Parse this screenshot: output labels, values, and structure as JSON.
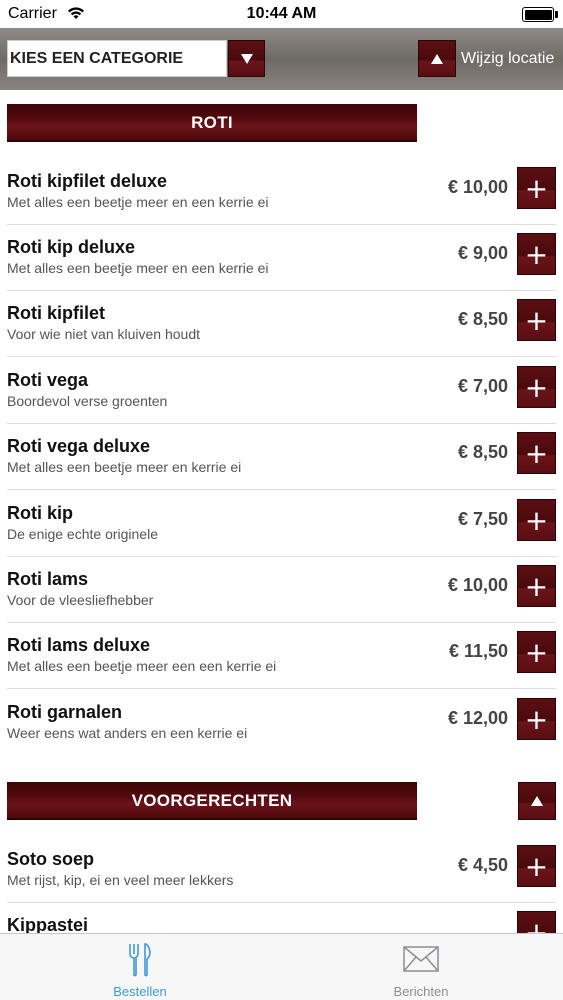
{
  "status_bar": {
    "carrier": "Carrier",
    "time": "10:44 AM"
  },
  "header": {
    "category_select": {
      "value": "KIES EEN CATEGORIE",
      "dropdown_icon": "triangle-down-icon"
    },
    "location_button": {
      "label": "Wijzig locatie",
      "icon": "triangle-up-icon"
    }
  },
  "sections": [
    {
      "title": "ROTI",
      "items": [
        {
          "name": "Roti kipfilet deluxe",
          "description": "Met alles een beetje meer en een kerrie ei",
          "price": "€ 10,00"
        },
        {
          "name": "Roti kip deluxe",
          "description": "Met alles een beetje meer en een kerrie ei",
          "price": "€ 9,00"
        },
        {
          "name": "Roti kipfilet",
          "description": "Voor wie niet van kluiven houdt",
          "price": "€ 8,50"
        },
        {
          "name": "Roti vega",
          "description": "Boordevol verse groenten",
          "price": "€ 7,00"
        },
        {
          "name": "Roti vega deluxe",
          "description": "Met alles een beetje meer en kerrie ei",
          "price": "€ 8,50"
        },
        {
          "name": "Roti kip",
          "description": "De enige echte originele",
          "price": "€ 7,50"
        },
        {
          "name": "Roti lams",
          "description": "Voor de vleesliefhebber",
          "price": "€ 10,00"
        },
        {
          "name": "Roti lams deluxe",
          "description": "Met alles een beetje meer een een kerrie ei",
          "price": "€ 11,50"
        },
        {
          "name": "Roti garnalen",
          "description": "Weer eens wat anders en een kerrie ei",
          "price": "€ 12,00"
        }
      ]
    },
    {
      "title": "VOORGERECHTEN",
      "items": [
        {
          "name": "Soto soep",
          "description": "Met rijst, kip, ei en veel meer lekkers",
          "price": "€ 4,50"
        },
        {
          "name": "Kippastei",
          "description": "",
          "price": ""
        }
      ]
    }
  ],
  "add_button_label": "+",
  "tabbar": {
    "tabs": [
      {
        "label": "Bestellen",
        "icon": "fork-knife-icon",
        "active": true
      },
      {
        "label": "Berichten",
        "icon": "envelope-icon",
        "active": false
      }
    ]
  },
  "colors": {
    "accent_dark_red": "#5b0f12",
    "tab_active": "#3f9ad8",
    "tab_inactive": "#8e8e93"
  }
}
